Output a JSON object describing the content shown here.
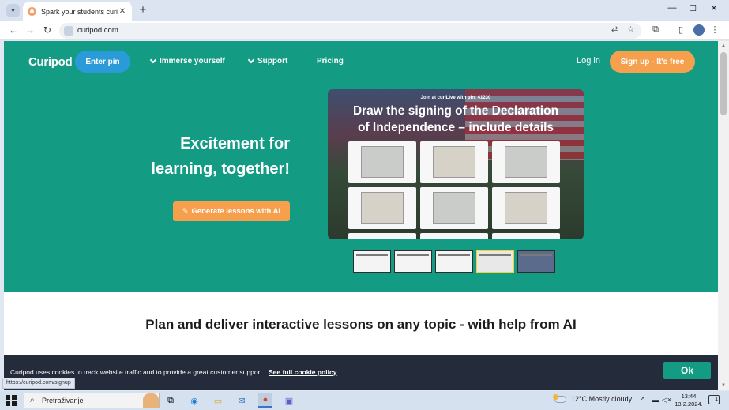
{
  "browser": {
    "tab_title": "Spark your students curiosity",
    "url": "curipod.com",
    "status_url": "https://curipod.com/signup"
  },
  "site": {
    "logo": "Curipod",
    "nav": {
      "enter_pin": "Enter pin",
      "immerse": "Immerse yourself",
      "support": "Support",
      "pricing": "Pricing",
      "login": "Log in",
      "signup": "Sign up - It's free"
    },
    "hero": {
      "headline_line1": "Excitement for",
      "headline_line2": "learning, together!",
      "generate_button": "Generate lessons with AI"
    },
    "preview": {
      "pin_text": "Join at curiLive with pin: 41230",
      "title_line1": "Draw the signing of the Declaration",
      "title_line2": "of Independence – include details"
    },
    "plan_text": "Plan and deliver interactive lessons on any topic - with help from AI",
    "cookie": {
      "text": "Curipod uses cookies to track website traffic and to provide a great customer support.",
      "link": "See full cookie policy",
      "ok": "Ok"
    }
  },
  "taskbar": {
    "search_text": "Pretraživanje",
    "weather_temp": "12°C",
    "weather_desc": "Mostly cloudy",
    "time": "13:44",
    "date": "13.2.2024."
  },
  "colors": {
    "hero_bg": "#149b84",
    "enter_pin_bg": "#2a9bd8",
    "accent_orange": "#f6a04d",
    "cookie_bg": "#242b3a"
  }
}
